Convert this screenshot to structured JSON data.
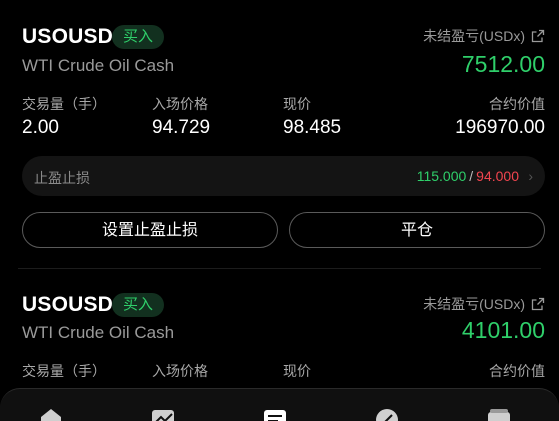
{
  "positions": [
    {
      "symbol": "USOUSD",
      "side": "买入",
      "description": "WTI Crude Oil Cash",
      "pnl_label": "未结盈亏(USDx)",
      "pnl_value": "7512.00",
      "volume_label": "交易量（手）",
      "volume": "2.00",
      "entry_label": "入场价格",
      "entry": "94.729",
      "current_label": "现价",
      "current": "98.485",
      "contract_label": "合约价值",
      "contract": "196970.00",
      "tpsl_label": "止盈止损",
      "tp": "115.000",
      "sl": "94.000",
      "tpsl_button": "设置止盈止损",
      "close_button": "平仓"
    },
    {
      "symbol": "USOUSD",
      "side": "买入",
      "description": "WTI Crude Oil Cash",
      "pnl_label": "未结盈亏(USDx)",
      "pnl_value": "4101.00",
      "volume_label": "交易量（手）",
      "entry_label": "入场价格",
      "current_label": "现价",
      "contract_label": "合约价值"
    }
  ],
  "colors": {
    "profit": "#2fcf6a",
    "loss": "#f2454f",
    "buy_badge_bg": "#12301f"
  },
  "tabbar": {
    "icons": [
      "home-icon",
      "chart-icon",
      "orders-icon",
      "discount-icon",
      "wallet-icon"
    ],
    "active": "orders-icon"
  }
}
